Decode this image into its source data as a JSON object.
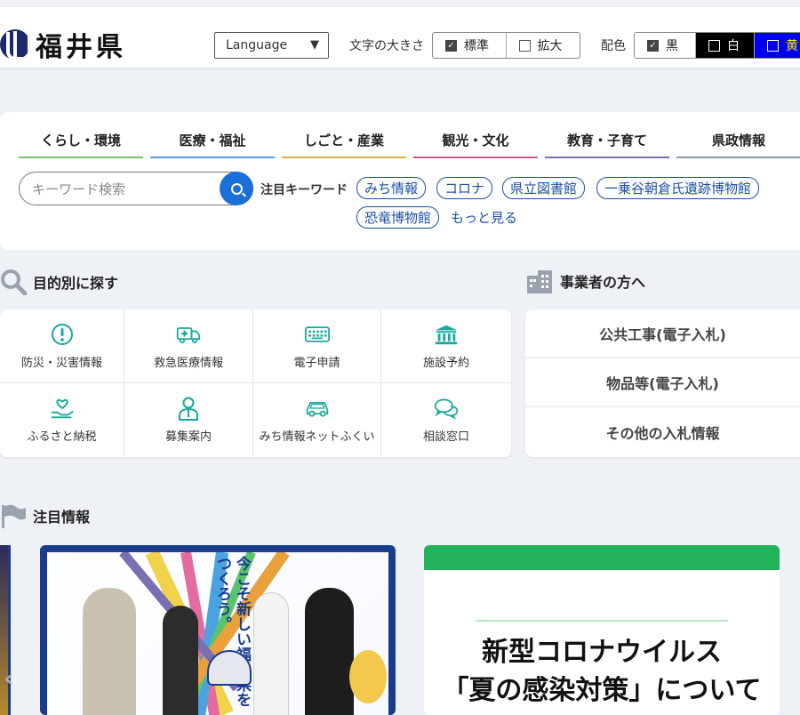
{
  "header": {
    "logo_text": "福井県",
    "language_label": "Language",
    "font_size_label": "文字の大きさ",
    "font_size_options": [
      "標準",
      "拡大"
    ],
    "color_label": "配色",
    "color_options": [
      "黒",
      "白",
      "黄"
    ]
  },
  "nav": {
    "tabs": [
      {
        "label": "くらし・環境",
        "color": "#7cbd6a"
      },
      {
        "label": "医療・福祉",
        "color": "#5a9fd6"
      },
      {
        "label": "しごと・産業",
        "color": "#d8b04a"
      },
      {
        "label": "観光・文化",
        "color": "#c0607a"
      },
      {
        "label": "教育・子育て",
        "color": "#7a6fb0"
      },
      {
        "label": "県政情報",
        "color": "#8a96a8"
      }
    ]
  },
  "search": {
    "placeholder": "キーワード検索",
    "keywords_label": "注目キーワード",
    "keywords": [
      "みち情報",
      "コロナ",
      "県立図書館",
      "一乗谷朝倉氏遺跡博物館",
      "恐竜博物館"
    ],
    "more": "もっと見る"
  },
  "purpose": {
    "heading": "目的別に探す",
    "items": [
      "防災・災害情報",
      "救急医療情報",
      "電子申請",
      "施設予約",
      "ふるさと納税",
      "募集案内",
      "みち情報ネットふくい",
      "相談窓口"
    ],
    "icons": [
      "alert-icon",
      "ambulance-icon",
      "keyboard-icon",
      "building-icon",
      "heart-hand-icon",
      "person-icon",
      "car-icon",
      "chat-icon"
    ]
  },
  "business": {
    "heading": "事業者の方へ",
    "items": [
      "公共工事(電子入札)",
      "物品等(電子入札)",
      "その他の入札情報"
    ]
  },
  "featured": {
    "heading": "注目情報",
    "banner1_text": "今こそ新しい福井県をつくろう。",
    "banner2_line1": "新型コロナウイルス",
    "banner2_line2": "「夏の感染対策」について"
  }
}
